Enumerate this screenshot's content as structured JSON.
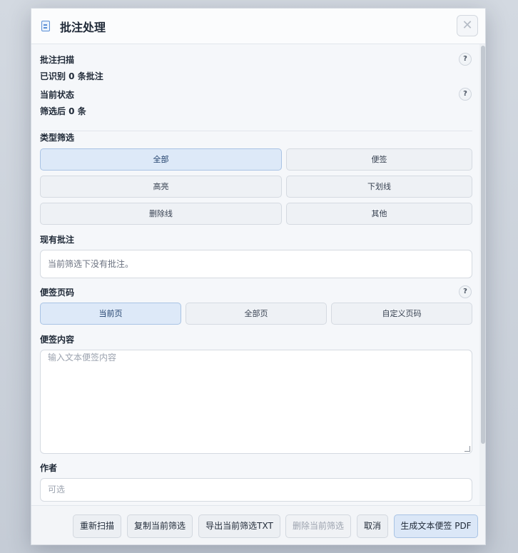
{
  "dialog": {
    "title": "批注处理",
    "title_icon": "document-icon",
    "close_glyph": "✕"
  },
  "scan": {
    "label": "批注扫描",
    "value": "已识别 0 条批注",
    "help": "?"
  },
  "status": {
    "label": "当前状态",
    "value": "筛选后 0 条",
    "help": "?"
  },
  "type_filter": {
    "label": "类型筛选",
    "options": [
      "全部",
      "便签",
      "高亮",
      "下划线",
      "删除线",
      "其他"
    ],
    "selected": "全部"
  },
  "existing": {
    "label": "现有批注",
    "empty_text": "当前筛选下没有批注。"
  },
  "note_page": {
    "label": "便签页码",
    "help": "?",
    "options": [
      "当前页",
      "全部页",
      "自定义页码"
    ],
    "selected": "当前页"
  },
  "note_content": {
    "label": "便签内容",
    "placeholder": "输入文本便签内容",
    "value": ""
  },
  "author": {
    "label": "作者",
    "placeholder": "可选",
    "value": ""
  },
  "footer": {
    "rescan": "重新扫描",
    "copy_filtered": "复制当前筛选",
    "export_txt": "导出当前筛选TXT",
    "delete_filtered": "删除当前筛选",
    "cancel": "取消",
    "create_note_pdf": "生成文本便签 PDF"
  },
  "colors": {
    "accent": "#dde9f8",
    "accent_border": "#a9c3e4",
    "backdrop": "#c9d0d9"
  }
}
